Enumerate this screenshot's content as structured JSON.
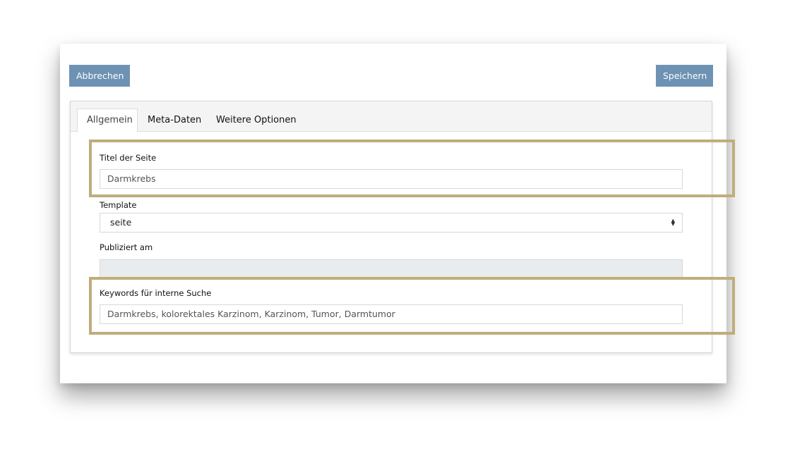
{
  "toolbar": {
    "cancel_label": "Abbrechen",
    "save_label": "Speichern"
  },
  "tabs": [
    {
      "label": "Allgemein",
      "active": true
    },
    {
      "label": "Meta-Daten",
      "active": false
    },
    {
      "label": "Weitere Optionen",
      "active": false
    }
  ],
  "form": {
    "title": {
      "label": "Titel der Seite",
      "value": "Darmkrebs"
    },
    "template": {
      "label": "Template",
      "selected": "seite"
    },
    "published": {
      "label": "Publiziert am",
      "value": ""
    },
    "keywords": {
      "label": "Keywords für interne Suche",
      "value": "Darmkrebs, kolorektales Karzinom, Karzinom, Tumor, Darmtumor"
    }
  },
  "colors": {
    "button": "#6d92b3",
    "highlight": "#bfad7a",
    "disabled_field": "#e9ecef"
  },
  "icons": {
    "select_arrows": "sort-arrows-icon"
  }
}
